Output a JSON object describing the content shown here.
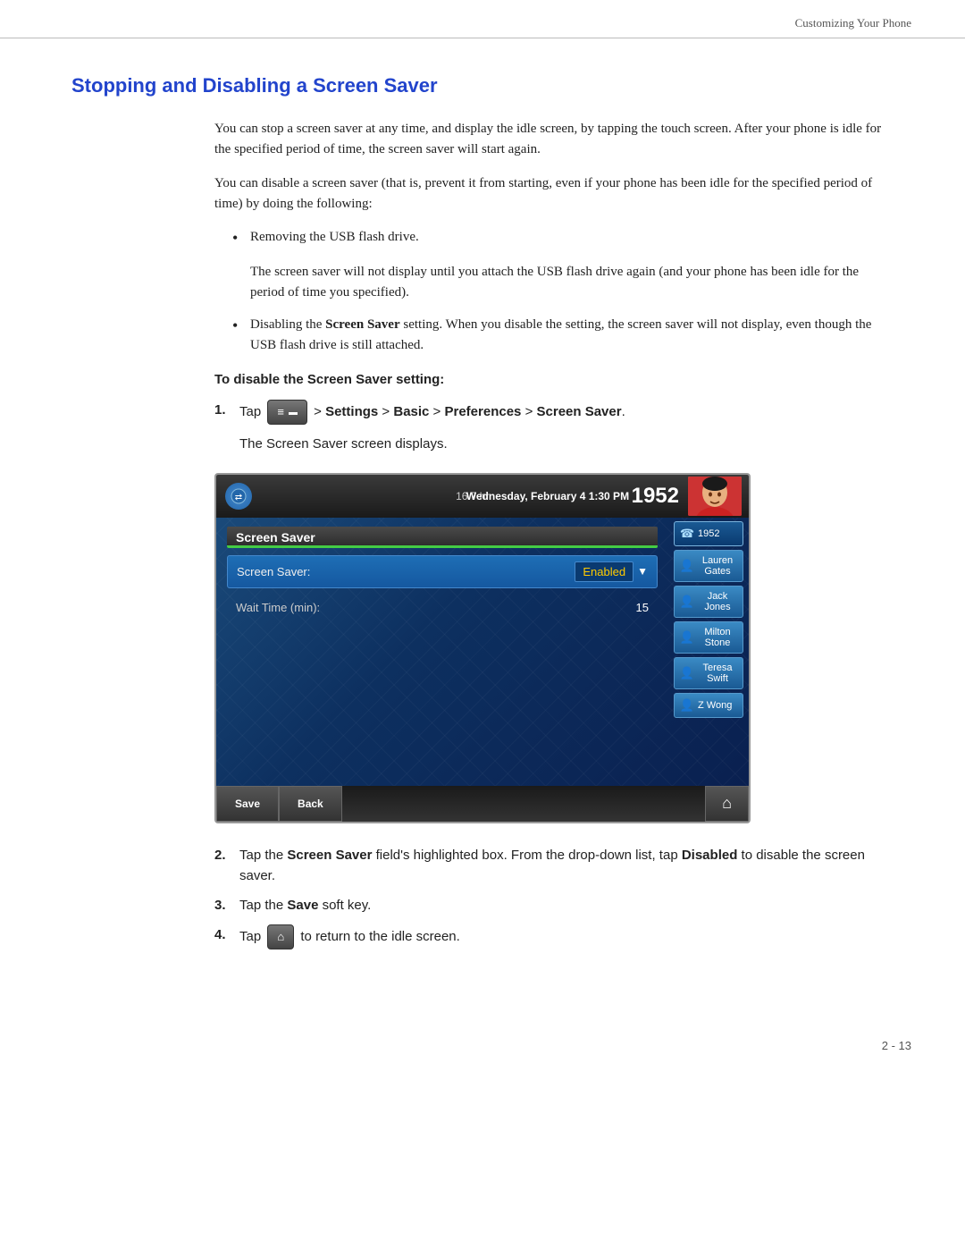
{
  "header": {
    "chapter": "Customizing Your Phone"
  },
  "title": "Stopping and Disabling a Screen Saver",
  "paragraphs": {
    "p1": "You can stop a screen saver at any time, and display the idle screen, by tapping the touch screen. After your phone is idle for the specified period of time, the screen saver will start again.",
    "p2": "You can disable a screen saver (that is, prevent it from starting, even if your phone has been idle for the specified period of time) by doing the following:"
  },
  "bullets": [
    {
      "text": "Removing the USB flash drive.",
      "subtext": "The screen saver will not display until you attach the USB flash drive again (and your phone has been idle for the period of time you specified)."
    },
    {
      "text_prefix": "Disabling the ",
      "bold": "Screen Saver",
      "text_suffix": " setting. When you disable the setting, the screen saver will not display, even though the USB flash drive is still attached.",
      "subtext": ""
    }
  ],
  "procedure_heading": "To disable the Screen Saver setting:",
  "steps": [
    {
      "num": "1.",
      "text_prefix": "Tap",
      "btn_label": "≡",
      "text_suffix": "> Settings > Basic > Preferences > Screen Saver.",
      "subtext": "The Screen Saver screen displays."
    },
    {
      "num": "2.",
      "text": "Tap the Screen Saver field's highlighted box. From the drop-down list, tap Disabled to disable the screen saver."
    },
    {
      "num": "3.",
      "text_prefix": "Tap the ",
      "bold": "Save",
      "text_suffix": " soft key."
    },
    {
      "num": "4.",
      "text_prefix": "Tap",
      "btn_label": "⌂",
      "text_suffix": "to return to the idle screen."
    }
  ],
  "phone_ui": {
    "time_idle": "16.7 hr",
    "datetime": "Wednesday, February 4  1:30 PM",
    "extension": "1952",
    "menu_title": "Screen Saver",
    "field_label": "Screen Saver:",
    "field_value": "Enabled",
    "wait_label": "Wait Time (min):",
    "wait_value": "15",
    "contacts": [
      {
        "name": "1952",
        "active": true
      },
      {
        "name": "Lauren Gates",
        "active": false
      },
      {
        "name": "Jack Jones",
        "active": false
      },
      {
        "name": "Milton Stone",
        "active": false
      },
      {
        "name": "Teresa Swift",
        "active": false
      },
      {
        "name": "Z Wong",
        "active": false
      }
    ],
    "soft_keys": {
      "save": "Save",
      "back": "Back"
    }
  },
  "page_number": "2 - 13"
}
